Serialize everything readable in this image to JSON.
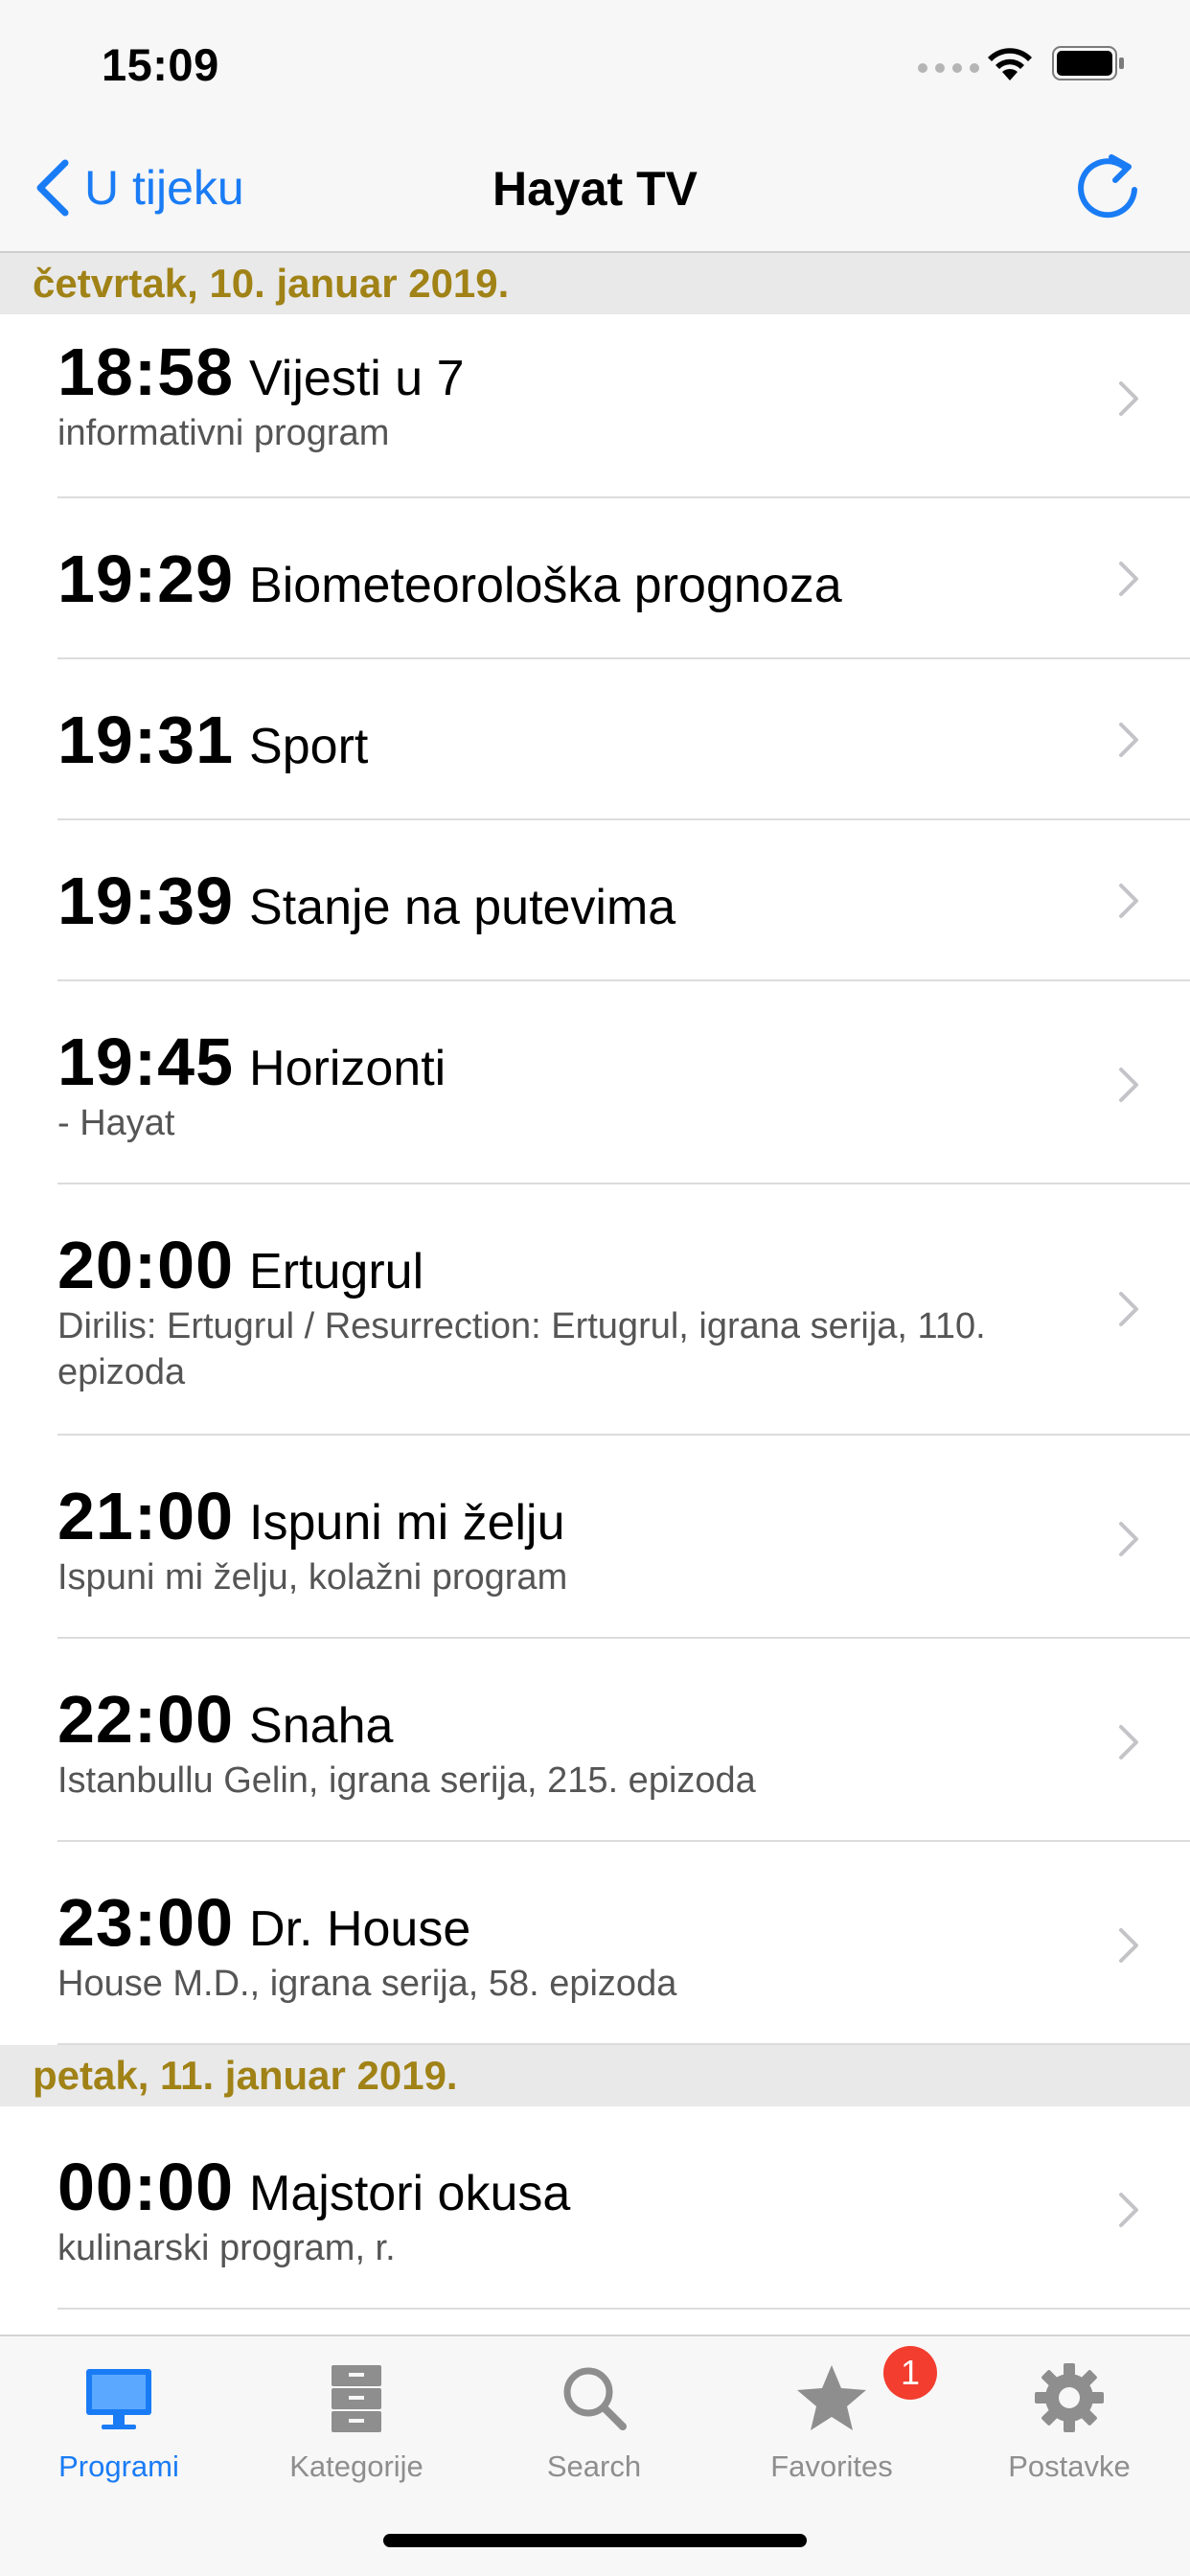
{
  "status_bar": {
    "time": "15:09"
  },
  "nav": {
    "back_label": "U tijeku",
    "title": "Hayat TV"
  },
  "colors": {
    "accent": "#1a7cf5",
    "section_text": "#a08216",
    "badge": "#f23d2f"
  },
  "sections": [
    {
      "header": "četvrtak, 10. januar 2019.",
      "rows": [
        {
          "time": "18:58",
          "title": "Vijesti u 7",
          "subtitle": "informativni program"
        },
        {
          "time": "19:29",
          "title": "Biometeorološka prognoza",
          "subtitle": ""
        },
        {
          "time": "19:31",
          "title": "Sport",
          "subtitle": ""
        },
        {
          "time": "19:39",
          "title": "Stanje na putevima",
          "subtitle": ""
        },
        {
          "time": "19:45",
          "title": "Horizonti",
          "subtitle": "- Hayat"
        },
        {
          "time": "20:00",
          "title": "Ertugrul",
          "subtitle": "Dirilis: Ertugrul / Resurrection: Ertugrul, igrana serija, 110. epizoda"
        },
        {
          "time": "21:00",
          "title": "Ispuni mi želju",
          "subtitle": "Ispuni mi želju, kolažni program"
        },
        {
          "time": "22:00",
          "title": "Snaha",
          "subtitle": "Istanbullu Gelin, igrana serija, 215. epizoda"
        },
        {
          "time": "23:00",
          "title": "Dr. House",
          "subtitle": "House M.D., igrana serija, 58. epizoda"
        }
      ]
    },
    {
      "header": "petak, 11. januar 2019.",
      "rows": [
        {
          "time": "00:00",
          "title": "Majstori okusa",
          "subtitle": "kulinarski program, r."
        }
      ]
    }
  ],
  "tabs": [
    {
      "label": "Programi",
      "icon": "tv-monitor-icon",
      "active": true
    },
    {
      "label": "Kategorije",
      "icon": "cabinet-icon",
      "active": false
    },
    {
      "label": "Search",
      "icon": "search-icon",
      "active": false
    },
    {
      "label": "Favorites",
      "icon": "star-icon",
      "active": false,
      "badge": "1"
    },
    {
      "label": "Postavke",
      "icon": "gear-icon",
      "active": false
    }
  ]
}
